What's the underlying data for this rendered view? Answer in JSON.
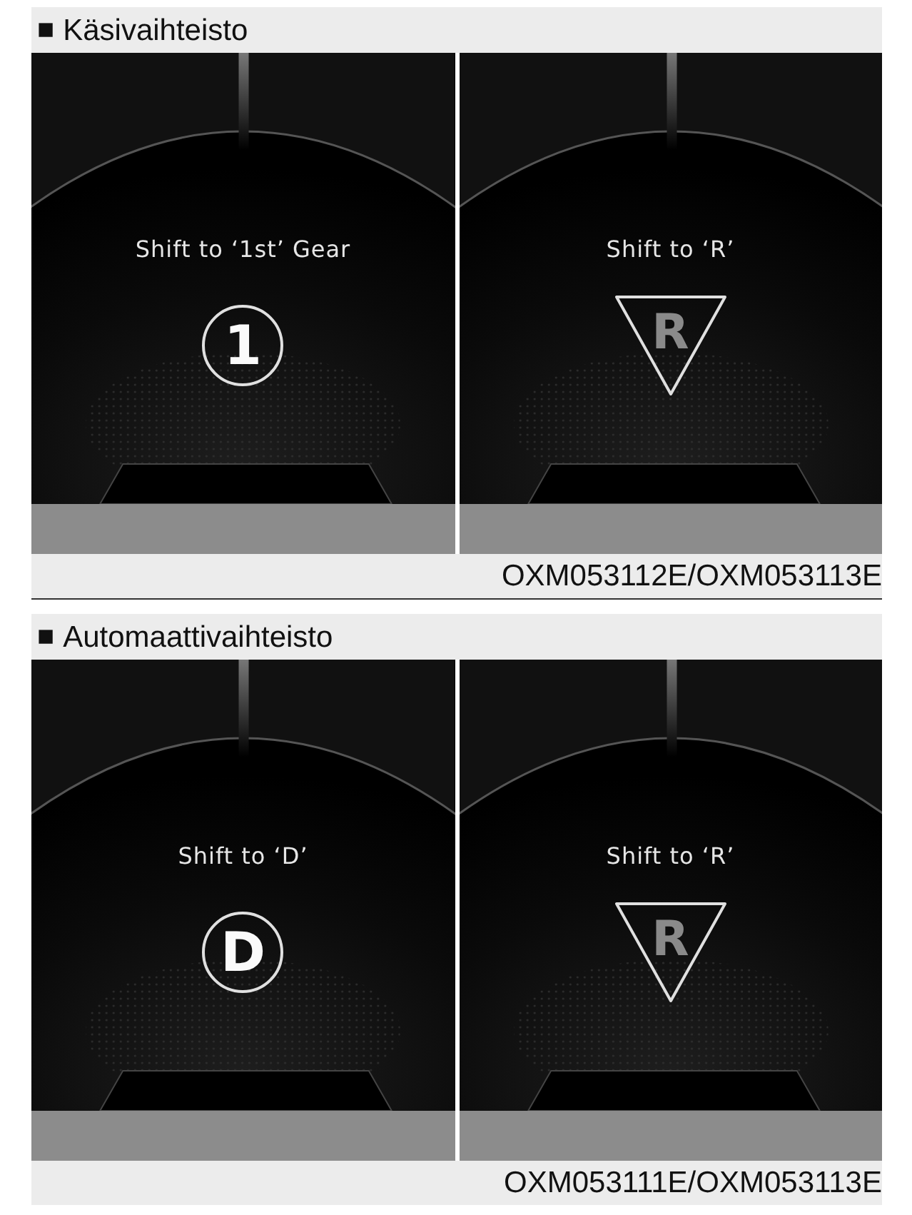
{
  "sections": [
    {
      "marker": "■",
      "title": "Käsivaihteisto",
      "displays": [
        {
          "message": "Shift to ‘1st’ Gear",
          "symbol": {
            "kind": "circle",
            "letter": "1"
          }
        },
        {
          "message": "Shift to ‘R’",
          "symbol": {
            "kind": "triangle",
            "letter": "R"
          }
        }
      ],
      "caption": "OXM053112E/OXM053113E"
    },
    {
      "marker": "■",
      "title": "Automaattivaihteisto",
      "displays": [
        {
          "message": "Shift to ‘D’",
          "symbol": {
            "kind": "circle",
            "letter": "D"
          }
        },
        {
          "message": "Shift to ‘R’",
          "symbol": {
            "kind": "triangle",
            "letter": "R"
          }
        }
      ],
      "caption": "OXM053111E/OXM053113E"
    }
  ]
}
